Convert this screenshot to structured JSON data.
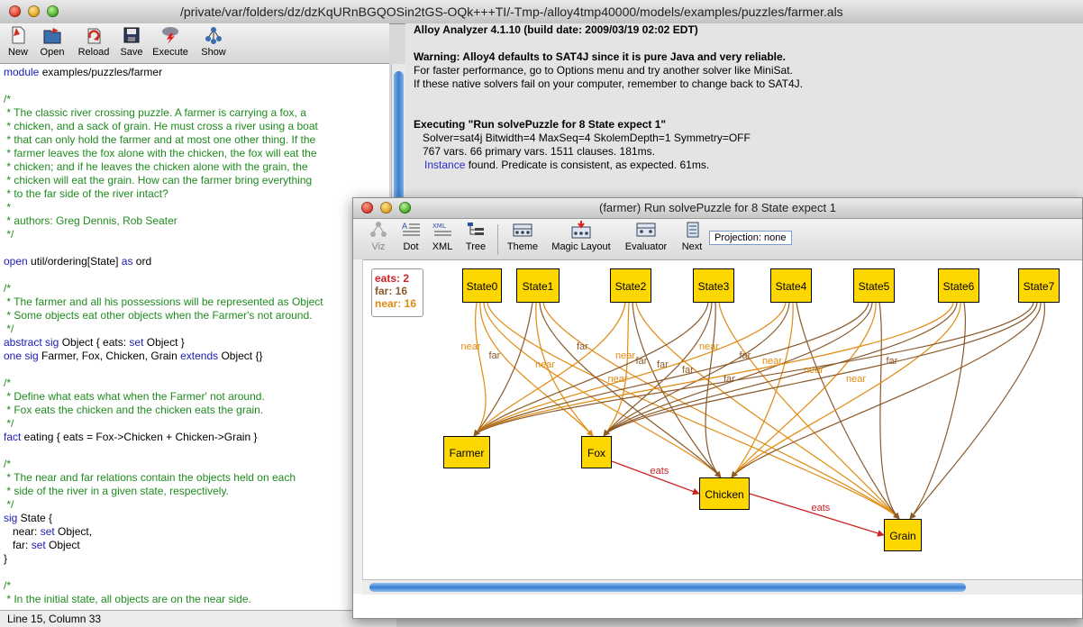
{
  "window": {
    "title": "/private/var/folders/dz/dzKqURnBGQOSin2tGS-OQk+++TI/-Tmp-/alloy4tmp40000/models/examples/puzzles/farmer.als"
  },
  "toolbar": {
    "new": "New",
    "open": "Open",
    "reload": "Reload",
    "save": "Save",
    "execute": "Execute",
    "show": "Show"
  },
  "editor": {
    "lines": [
      "module examples/puzzles/farmer",
      "",
      "/*",
      " * The classic river crossing puzzle. A farmer is carrying a fox, a",
      " * chicken, and a sack of grain. He must cross a river using a boat",
      " * that can only hold the farmer and at most one other thing. If the",
      " * farmer leaves the fox alone with the chicken, the fox will eat the",
      " * chicken; and if he leaves the chicken alone with the grain, the",
      " * chicken will eat the grain. How can the farmer bring everything",
      " * to the far side of the river intact?",
      " *",
      " * authors: Greg Dennis, Rob Seater",
      " */",
      "",
      "open util/ordering[State] as ord",
      "",
      "/*",
      " * The farmer and all his possessions will be represented as Object",
      " * Some objects eat other objects when the Farmer's not around.",
      " */",
      "abstract sig Object { eats: set Object }",
      "one sig Farmer, Fox, Chicken, Grain extends Object {}",
      "",
      "/*",
      " * Define what eats what when the Farmer' not around.",
      " * Fox eats the chicken and the chicken eats the grain.",
      " */",
      "fact eating { eats = Fox->Chicken + Chicken->Grain }",
      "",
      "/*",
      " * The near and far relations contain the objects held on each",
      " * side of the river in a given state, respectively.",
      " */",
      "sig State {",
      "   near: set Object,",
      "   far: set Object",
      "}",
      "",
      "/*",
      " * In the initial state, all objects are on the near side."
    ],
    "status": "Line 15, Column 33"
  },
  "messages": {
    "header": "Alloy Analyzer 4.1.10 (build date: 2009/03/19 02:02 EDT)",
    "warning_title": "Warning: Alloy4 defaults to SAT4J since it is pure Java and very reliable.",
    "warning_1": "For faster performance, go to Options menu and try another solver like MiniSat.",
    "warning_2": "If these native solvers fail on your computer, remember to change back to SAT4J.",
    "exec_title": "Executing \"Run solvePuzzle for 8 State expect 1\"",
    "exec_1": "   Solver=sat4j Bitwidth=4 MaxSeq=4 SkolemDepth=1 Symmetry=OFF",
    "exec_2": "   767 vars. 66 primary vars. 1511 clauses. 181ms.",
    "instance_link": "Instance",
    "exec_3_rest": " found. Predicate is consistent, as expected. 61ms."
  },
  "viz": {
    "title": "(farmer) Run solvePuzzle for 8 State expect 1",
    "tools": {
      "viz": "Viz",
      "dot": "Dot",
      "xml": "XML",
      "tree": "Tree",
      "theme": "Theme",
      "magic": "Magic Layout",
      "evaluator": "Evaluator",
      "next": "Next"
    },
    "projection": "Projection: none",
    "legend": {
      "eats": "eats: 2",
      "far": "far: 16",
      "near": "near: 16"
    },
    "colors": {
      "eats": "#cc2222",
      "far": "#8b5a2b",
      "near": "#e08a10",
      "node": "#ffd700"
    },
    "states": [
      "State0",
      "State1",
      "State2",
      "State3",
      "State4",
      "State5",
      "State6",
      "State7"
    ],
    "objects": [
      "Farmer",
      "Fox",
      "Chicken",
      "Grain"
    ],
    "edge_labels": {
      "near": "near",
      "far": "far",
      "eats": "eats"
    }
  }
}
